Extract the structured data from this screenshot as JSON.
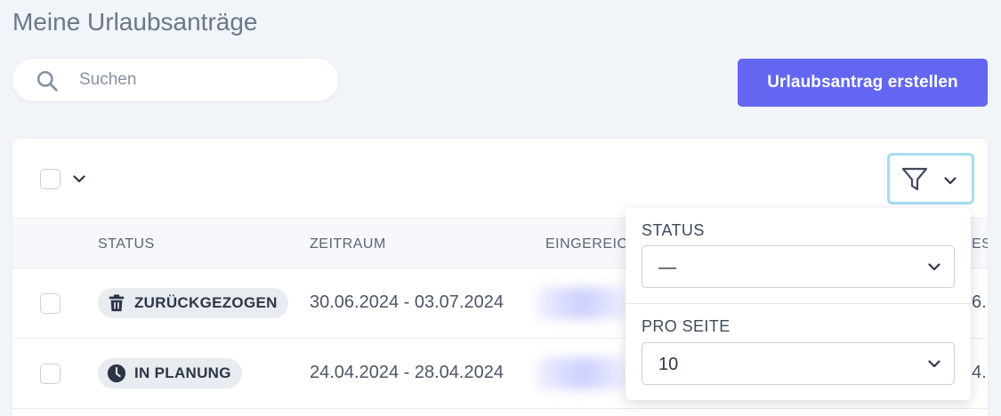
{
  "header": {
    "title": "Meine Urlaubsanträge"
  },
  "search": {
    "placeholder": "Suchen"
  },
  "actions": {
    "create_label": "Urlaubsantrag erstellen"
  },
  "table": {
    "columns": [
      "STATUS",
      "ZEITRAUM",
      "EINGEREIC",
      "ES"
    ],
    "rows": [
      {
        "status": "ZURÜCKGEZOGEN",
        "status_icon": "trash-icon",
        "period": "30.06.2024 - 03.07.2024",
        "edge": "6."
      },
      {
        "status": "IN PLANUNG",
        "status_icon": "clock-icon",
        "period": "24.04.2024 - 28.04.2024",
        "edge": "4."
      }
    ]
  },
  "filter_panel": {
    "status_label": "STATUS",
    "status_value": "—",
    "per_page_label": "PRO SEITE",
    "per_page_value": "10"
  },
  "colors": {
    "accent": "#6366f1",
    "background": "#f1f4f9",
    "focus_ring": "#a7dbf2"
  }
}
